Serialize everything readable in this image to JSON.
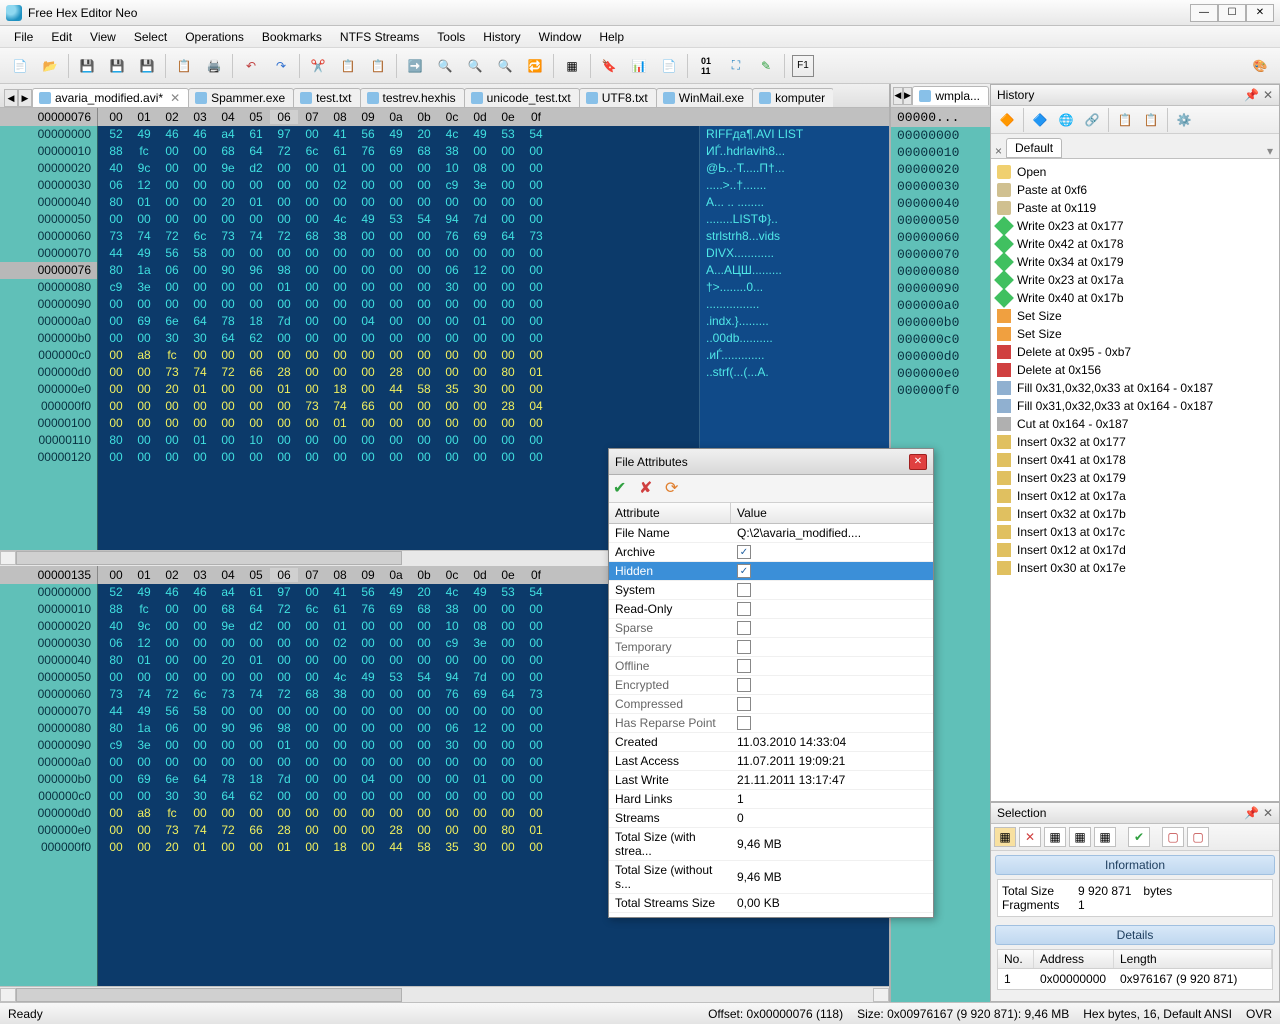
{
  "title": "Free Hex Editor Neo",
  "menu": [
    "File",
    "Edit",
    "View",
    "Select",
    "Operations",
    "Bookmarks",
    "NTFS Streams",
    "Tools",
    "History",
    "Window",
    "Help"
  ],
  "tabs": [
    "avaria_modified.avi*",
    "Spammer.exe",
    "test.txt",
    "testrev.hexhis",
    "unicode_test.txt",
    "UTF8.txt",
    "WinMail.exe",
    "komputer"
  ],
  "active_tab": 0,
  "sec_tab": "wmpla...",
  "hex": {
    "cursor_col": "06",
    "cursor_off_1": "00000076",
    "cursor_off_2": "00000135",
    "cols": [
      "00",
      "01",
      "02",
      "03",
      "04",
      "05",
      "06",
      "07",
      "08",
      "09",
      "0a",
      "0b",
      "0c",
      "0d",
      "0e",
      "0f"
    ],
    "offsets_1": [
      "00000000",
      "00000010",
      "00000020",
      "00000030",
      "00000040",
      "00000050",
      "00000060",
      "00000070",
      "00000076",
      "00000080",
      "00000090",
      "000000a0",
      "000000b0",
      "000000c0",
      "000000d0",
      "000000e0",
      "000000f0",
      "00000100",
      "00000110",
      "00000120"
    ],
    "rows_1": [
      [
        "52",
        "49",
        "46",
        "46",
        "a4",
        "61",
        "97",
        "00",
        "41",
        "56",
        "49",
        "20",
        "4c",
        "49",
        "53",
        "54"
      ],
      [
        "88",
        "fc",
        "00",
        "00",
        "68",
        "64",
        "72",
        "6c",
        "61",
        "76",
        "69",
        "68",
        "38",
        "00",
        "00",
        "00"
      ],
      [
        "40",
        "9c",
        "00",
        "00",
        "9e",
        "d2",
        "00",
        "00",
        "01",
        "00",
        "00",
        "00",
        "10",
        "08",
        "00",
        "00"
      ],
      [
        "06",
        "12",
        "00",
        "00",
        "00",
        "00",
        "00",
        "00",
        "02",
        "00",
        "00",
        "00",
        "c9",
        "3e",
        "00",
        "00"
      ],
      [
        "80",
        "01",
        "00",
        "00",
        "20",
        "01",
        "00",
        "00",
        "00",
        "00",
        "00",
        "00",
        "00",
        "00",
        "00",
        "00"
      ],
      [
        "00",
        "00",
        "00",
        "00",
        "00",
        "00",
        "00",
        "00",
        "4c",
        "49",
        "53",
        "54",
        "94",
        "7d",
        "00",
        "00"
      ],
      [
        "73",
        "74",
        "72",
        "6c",
        "73",
        "74",
        "72",
        "68",
        "38",
        "00",
        "00",
        "00",
        "76",
        "69",
        "64",
        "73"
      ],
      [
        "44",
        "49",
        "56",
        "58",
        "00",
        "00",
        "00",
        "00",
        "00",
        "00",
        "00",
        "00",
        "00",
        "00",
        "00",
        "00"
      ],
      [
        "80",
        "1a",
        "06",
        "00",
        "90",
        "96",
        "98",
        "00",
        "00",
        "00",
        "00",
        "00",
        "06",
        "12",
        "00",
        "00"
      ],
      [
        "c9",
        "3e",
        "00",
        "00",
        "00",
        "00",
        "01",
        "00",
        "00",
        "00",
        "00",
        "00",
        "30",
        "00",
        "00",
        "00"
      ],
      [
        "00",
        "00",
        "00",
        "00",
        "00",
        "00",
        "00",
        "00",
        "00",
        "00",
        "00",
        "00",
        "00",
        "00",
        "00",
        "00"
      ],
      [
        "00",
        "69",
        "6e",
        "64",
        "78",
        "18",
        "7d",
        "00",
        "00",
        "04",
        "00",
        "00",
        "00",
        "01",
        "00",
        "00"
      ],
      [
        "00",
        "00",
        "30",
        "30",
        "64",
        "62",
        "00",
        "00",
        "00",
        "00",
        "00",
        "00",
        "00",
        "00",
        "00",
        "00"
      ],
      [
        "00",
        "a8",
        "fc",
        "00",
        "00",
        "00",
        "00",
        "00",
        "00",
        "00",
        "00",
        "00",
        "00",
        "00",
        "00",
        "00"
      ],
      [
        "00",
        "00",
        "73",
        "74",
        "72",
        "66",
        "28",
        "00",
        "00",
        "00",
        "28",
        "00",
        "00",
        "00",
        "80",
        "01"
      ],
      [
        "00",
        "00",
        "20",
        "01",
        "00",
        "00",
        "01",
        "00",
        "18",
        "00",
        "44",
        "58",
        "35",
        "30",
        "00",
        "00"
      ],
      [
        "00",
        "00",
        "00",
        "00",
        "00",
        "00",
        "00",
        "73",
        "74",
        "66",
        "00",
        "00",
        "00",
        "00",
        "28",
        "04"
      ],
      [
        "00",
        "00",
        "00",
        "00",
        "00",
        "00",
        "00",
        "00",
        "01",
        "00",
        "00",
        "00",
        "00",
        "00",
        "00",
        "00"
      ],
      [
        "80",
        "00",
        "00",
        "01",
        "00",
        "10",
        "00",
        "00",
        "00",
        "00",
        "00",
        "00",
        "00",
        "00",
        "00",
        "00"
      ],
      [
        "00",
        "00",
        "00",
        "00",
        "00",
        "00",
        "00",
        "00",
        "00",
        "00",
        "00",
        "00",
        "00",
        "00",
        "00",
        "00"
      ]
    ],
    "yellow_rows_1": [
      13,
      14,
      15,
      16,
      17
    ],
    "ascii_1": [
      "RIFFдa¶.AVI LIST",
      "ИЃ..hdrlavih8...",
      "@Ь..·Т.....П†...",
      ".....>..†.......",
      "А... .. ........",
      "........LISTФ}..",
      "strlstrh8...vids",
      "DIVX............",
      "А...АЦШ.........",
      "†>........0...",
      "................",
      ".indx.}.........",
      "..00db..........",
      ".иЃ.............",
      "..strf(...(...А."
    ],
    "offsets_2": [
      "00000000",
      "00000010",
      "00000020",
      "00000030",
      "00000040",
      "00000050",
      "00000060",
      "00000070",
      "00000080",
      "00000090",
      "000000a0",
      "000000b0",
      "000000c0",
      "000000d0",
      "000000e0",
      "000000f0"
    ],
    "rows_2": [
      [
        "52",
        "49",
        "46",
        "46",
        "a4",
        "61",
        "97",
        "00",
        "41",
        "56",
        "49",
        "20",
        "4c",
        "49",
        "53",
        "54"
      ],
      [
        "88",
        "fc",
        "00",
        "00",
        "68",
        "64",
        "72",
        "6c",
        "61",
        "76",
        "69",
        "68",
        "38",
        "00",
        "00",
        "00"
      ],
      [
        "40",
        "9c",
        "00",
        "00",
        "9e",
        "d2",
        "00",
        "00",
        "01",
        "00",
        "00",
        "00",
        "10",
        "08",
        "00",
        "00"
      ],
      [
        "06",
        "12",
        "00",
        "00",
        "00",
        "00",
        "00",
        "00",
        "02",
        "00",
        "00",
        "00",
        "c9",
        "3e",
        "00",
        "00"
      ],
      [
        "80",
        "01",
        "00",
        "00",
        "20",
        "01",
        "00",
        "00",
        "00",
        "00",
        "00",
        "00",
        "00",
        "00",
        "00",
        "00"
      ],
      [
        "00",
        "00",
        "00",
        "00",
        "00",
        "00",
        "00",
        "00",
        "4c",
        "49",
        "53",
        "54",
        "94",
        "7d",
        "00",
        "00"
      ],
      [
        "73",
        "74",
        "72",
        "6c",
        "73",
        "74",
        "72",
        "68",
        "38",
        "00",
        "00",
        "00",
        "76",
        "69",
        "64",
        "73"
      ],
      [
        "44",
        "49",
        "56",
        "58",
        "00",
        "00",
        "00",
        "00",
        "00",
        "00",
        "00",
        "00",
        "00",
        "00",
        "00",
        "00"
      ],
      [
        "80",
        "1a",
        "06",
        "00",
        "90",
        "96",
        "98",
        "00",
        "00",
        "00",
        "00",
        "00",
        "06",
        "12",
        "00",
        "00"
      ],
      [
        "c9",
        "3e",
        "00",
        "00",
        "00",
        "00",
        "01",
        "00",
        "00",
        "00",
        "00",
        "00",
        "30",
        "00",
        "00",
        "00"
      ],
      [
        "00",
        "00",
        "00",
        "00",
        "00",
        "00",
        "00",
        "00",
        "00",
        "00",
        "00",
        "00",
        "00",
        "00",
        "00",
        "00"
      ],
      [
        "00",
        "69",
        "6e",
        "64",
        "78",
        "18",
        "7d",
        "00",
        "00",
        "04",
        "00",
        "00",
        "00",
        "01",
        "00",
        "00"
      ],
      [
        "00",
        "00",
        "30",
        "30",
        "64",
        "62",
        "00",
        "00",
        "00",
        "00",
        "00",
        "00",
        "00",
        "00",
        "00",
        "00"
      ],
      [
        "00",
        "a8",
        "fc",
        "00",
        "00",
        "00",
        "00",
        "00",
        "00",
        "00",
        "00",
        "00",
        "00",
        "00",
        "00",
        "00"
      ],
      [
        "00",
        "00",
        "73",
        "74",
        "72",
        "66",
        "28",
        "00",
        "00",
        "00",
        "28",
        "00",
        "00",
        "00",
        "80",
        "01"
      ],
      [
        "00",
        "00",
        "20",
        "01",
        "00",
        "00",
        "01",
        "00",
        "18",
        "00",
        "44",
        "58",
        "35",
        "30",
        "00",
        "00"
      ]
    ],
    "yellow_rows_2": [
      13,
      14,
      15
    ]
  },
  "file_attributes": {
    "title": "File Attributes",
    "cols": [
      "Attribute",
      "Value"
    ],
    "rows": [
      {
        "a": "File Name",
        "b": "Q:\\2\\avaria_modified....",
        "type": "text",
        "en": true
      },
      {
        "a": "Archive",
        "b": "",
        "type": "check",
        "checked": true,
        "en": true
      },
      {
        "a": "Hidden",
        "b": "",
        "type": "check",
        "checked": true,
        "en": true,
        "sel": true
      },
      {
        "a": "System",
        "b": "",
        "type": "check",
        "checked": false,
        "en": true
      },
      {
        "a": "Read-Only",
        "b": "",
        "type": "check",
        "checked": false,
        "en": true
      },
      {
        "a": "Sparse",
        "b": "",
        "type": "check",
        "checked": false,
        "en": false
      },
      {
        "a": "Temporary",
        "b": "",
        "type": "check",
        "checked": false,
        "en": false
      },
      {
        "a": "Offline",
        "b": "",
        "type": "check",
        "checked": false,
        "en": false
      },
      {
        "a": "Encrypted",
        "b": "",
        "type": "check",
        "checked": false,
        "en": false
      },
      {
        "a": "Compressed",
        "b": "",
        "type": "check",
        "checked": false,
        "en": false
      },
      {
        "a": "Has Reparse Point",
        "b": "",
        "type": "check",
        "checked": false,
        "en": false
      },
      {
        "a": "Created",
        "b": "11.03.2010 14:33:04",
        "type": "text",
        "en": true
      },
      {
        "a": "Last Access",
        "b": "11.07.2011 19:09:21",
        "type": "text",
        "en": true
      },
      {
        "a": "Last Write",
        "b": "21.11.2011 13:17:47",
        "type": "text",
        "en": true
      },
      {
        "a": "Hard Links",
        "b": "1",
        "type": "text",
        "en": true
      },
      {
        "a": "Streams",
        "b": "0",
        "type": "text",
        "en": true
      },
      {
        "a": "Total Size (with strea...",
        "b": "9,46 MB",
        "type": "text",
        "en": true
      },
      {
        "a": "Total Size (without s...",
        "b": "9,46 MB",
        "type": "text",
        "en": true
      },
      {
        "a": "Total Streams Size",
        "b": "0,00 KB",
        "type": "text",
        "en": true
      }
    ]
  },
  "history": {
    "title": "History",
    "default_tab": "Default",
    "items": [
      {
        "t": "Open",
        "ico": "folder"
      },
      {
        "t": "Paste at 0xf6",
        "ico": "paste"
      },
      {
        "t": "Paste at 0x119",
        "ico": "paste"
      },
      {
        "t": "Write 0x23 at 0x177",
        "ico": "write"
      },
      {
        "t": "Write 0x42 at 0x178",
        "ico": "write"
      },
      {
        "t": "Write 0x34 at 0x179",
        "ico": "write"
      },
      {
        "t": "Write 0x23 at 0x17a",
        "ico": "write"
      },
      {
        "t": "Write 0x40 at 0x17b",
        "ico": "write"
      },
      {
        "t": "Set Size",
        "ico": "size"
      },
      {
        "t": "Set Size",
        "ico": "size"
      },
      {
        "t": "Delete at 0x95 - 0xb7",
        "ico": "del"
      },
      {
        "t": "Delete at 0x156",
        "ico": "del"
      },
      {
        "t": "Fill 0x31,0x32,0x33 at 0x164 - 0x187",
        "ico": "fill"
      },
      {
        "t": "Fill 0x31,0x32,0x33 at 0x164 - 0x187",
        "ico": "fill"
      },
      {
        "t": "Cut at 0x164 - 0x187",
        "ico": "cut"
      },
      {
        "t": "Insert 0x32 at 0x177",
        "ico": "ins"
      },
      {
        "t": "Insert 0x41 at 0x178",
        "ico": "ins"
      },
      {
        "t": "Insert 0x23 at 0x179",
        "ico": "ins"
      },
      {
        "t": "Insert 0x12 at 0x17a",
        "ico": "ins"
      },
      {
        "t": "Insert 0x32 at 0x17b",
        "ico": "ins"
      },
      {
        "t": "Insert 0x13 at 0x17c",
        "ico": "ins"
      },
      {
        "t": "Insert 0x12 at 0x17d",
        "ico": "ins"
      },
      {
        "t": "Insert 0x30 at 0x17e",
        "ico": "ins"
      }
    ]
  },
  "selection": {
    "title": "Selection",
    "info_title": "Information",
    "total_size_label": "Total Size",
    "total_size_value": "9 920 871",
    "total_size_unit": "bytes",
    "fragments_label": "Fragments",
    "fragments_value": "1",
    "details_title": "Details",
    "cols": [
      "No.",
      "Address",
      "Length"
    ],
    "row": [
      "1",
      "0x00000000",
      "0x976167 (9 920 871)"
    ]
  },
  "status": {
    "ready": "Ready",
    "offset": "Offset: 0x00000076 (118)",
    "size": "Size: 0x00976167 (9 920 871): 9,46 MB",
    "mode": "Hex bytes, 16, Default ANSI",
    "ovr": "OVR"
  },
  "sec_offsets": [
    "00000000",
    "00000010",
    "00000020",
    "00000030",
    "00000040",
    "00000050",
    "00000060",
    "00000070",
    "00000080",
    "00000090",
    "000000a0",
    "000000b0",
    "000000c0",
    "000000d0",
    "000000e0",
    "000000f0"
  ]
}
